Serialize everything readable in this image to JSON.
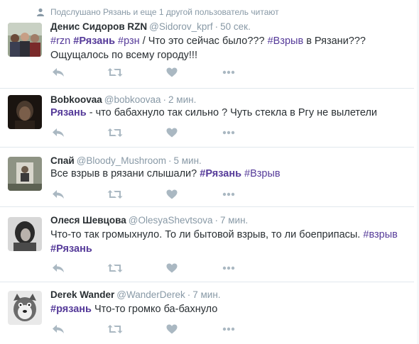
{
  "context": {
    "text": "Подслушано Рязань и еще 1 другой пользователь читают",
    "icon": "person-icon"
  },
  "colors": {
    "hashtag": "#553a99",
    "muted": "#8899a6",
    "text": "#292f33",
    "divider": "#e1e8ed"
  },
  "tweets": [
    {
      "fullname": "Денис Сидоров RZN",
      "username": "@Sidorov_kprf",
      "time": "50 сек.",
      "parts": [
        {
          "t": "#rzn",
          "c": "tag"
        },
        {
          "t": " ",
          "c": "txt"
        },
        {
          "t": "#Рязань",
          "c": "tagb"
        },
        {
          "t": " ",
          "c": "txt"
        },
        {
          "t": "#рзн",
          "c": "tag"
        },
        {
          "t": "  / Что это сейчас было??? ",
          "c": "txt"
        },
        {
          "t": "#Взрыв",
          "c": "tag"
        },
        {
          "t": " в Рязани??? Ощущалось по всему городу!!!",
          "c": "txt"
        }
      ]
    },
    {
      "fullname": "Bobkoovaa",
      "username": "@bobkoovaa",
      "time": "2 мин.",
      "parts": [
        {
          "t": "Рязань",
          "c": "tagb"
        },
        {
          "t": " - что бабахнуло так сильно ? Чуть стекла в Pгу не вылетели",
          "c": "txt"
        }
      ]
    },
    {
      "fullname": "Спай",
      "username": "@Bloody_Mushroom",
      "time": "5 мин.",
      "parts": [
        {
          "t": "Все взрыв в рязани слышали? ",
          "c": "txt"
        },
        {
          "t": "#Рязань",
          "c": "tagb"
        },
        {
          "t": " ",
          "c": "txt"
        },
        {
          "t": "#Взрыв",
          "c": "tag"
        }
      ]
    },
    {
      "fullname": "Олеся Шевцова",
      "username": "@OlesyaShevtsova",
      "time": "7 мин.",
      "parts": [
        {
          "t": "Что-то так громыхнуло. То ли бытовой взрыв, то ли боеприпасы. ",
          "c": "txt"
        },
        {
          "t": "#взрыв",
          "c": "tag"
        },
        {
          "t": " ",
          "c": "txt"
        },
        {
          "t": "#Рязань",
          "c": "tagb"
        }
      ]
    },
    {
      "fullname": "Derek Wander",
      "username": "@WanderDerek",
      "time": "7 мин.",
      "parts": [
        {
          "t": "#рязань",
          "c": "tagb"
        },
        {
          "t": " Что-то громко ба-бахнуло",
          "c": "txt"
        }
      ]
    }
  ],
  "actions": {
    "reply": "reply-icon",
    "retweet": "retweet-icon",
    "like": "heart-icon",
    "more": "more-icon"
  }
}
